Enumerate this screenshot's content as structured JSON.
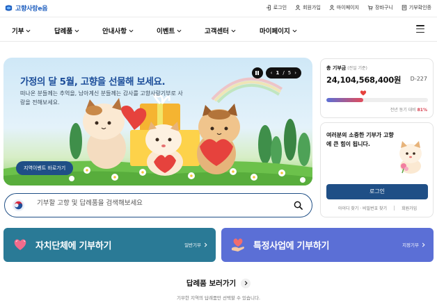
{
  "brand": {
    "logo_text": "고향사랑e음",
    "color": "#1f5fbf"
  },
  "top_links": [
    {
      "label": "로그인",
      "icon": "login-icon"
    },
    {
      "label": "회원가입",
      "icon": "user-plus-icon"
    },
    {
      "label": "마이페이지",
      "icon": "user-icon"
    },
    {
      "label": "장바구니",
      "icon": "cart-icon"
    },
    {
      "label": "기부확인증",
      "icon": "certificate-icon"
    }
  ],
  "nav": {
    "items": [
      "기부",
      "답례품",
      "안내사항",
      "이벤트",
      "고객센터",
      "마이페이지"
    ],
    "menu_icon": "hamburger-icon"
  },
  "banner": {
    "title": "가정의 달 5월, 고향을 선물해 보세요.",
    "subtitle": "떠나온 분들께는 추억을, 남아계신 분들께는 감사를 고향사랑기부로 사랑을 전해보세요.",
    "cta": "지역이벤트 바로가기",
    "pager_current": "1",
    "pager_total": "5",
    "pager_prev": "‹",
    "pager_next": "›",
    "pager_sep": "/"
  },
  "search": {
    "placeholder": "기부할 고향 및 답례품을 검색해보세요"
  },
  "cards": {
    "local": {
      "title": "자치단체에 기부하기",
      "link": "일반기부",
      "color": "#2a7a96"
    },
    "special": {
      "title": "특정사업에 기부하기",
      "link": "지정기부",
      "color": "#5b6fd6"
    }
  },
  "gifts": {
    "title": "답례품 보러가기",
    "desc": "기부한 지역의 답례품만 선택할 수 있습니다."
  },
  "total": {
    "label": "총 기부금",
    "basis": "(전일 기준)",
    "amount": "24,104,568,400원",
    "dday": "D-227",
    "progress_percent": 81,
    "note_prefix": "전년 동기 대비",
    "note_value": "81%"
  },
  "login_panel": {
    "message": "여러분의 소중한 기부가 고향에 큰 힘이 됩니다.",
    "login_button": "로그인",
    "find_link": "아이디 찾기 · 비밀번호 찾기",
    "signup_link": "회원가입"
  }
}
